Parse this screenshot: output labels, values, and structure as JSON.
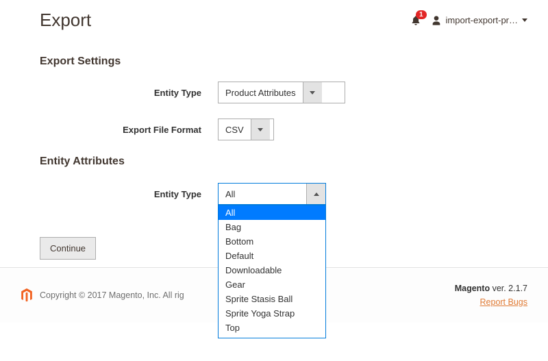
{
  "header": {
    "title": "Export",
    "notification_count": "1",
    "user_name": "import-export-pr…"
  },
  "sections": {
    "export_settings_title": "Export Settings",
    "entity_attributes_title": "Entity Attributes"
  },
  "fields": {
    "entity_type_label": "Entity Type",
    "entity_type_value": "Product Attributes",
    "export_file_format_label": "Export File Format",
    "export_file_format_value": "CSV",
    "attr_entity_type_label": "Entity Type",
    "attr_entity_type_value": "All"
  },
  "dropdown_options": [
    "All",
    "Bag",
    "Bottom",
    "Default",
    "Downloadable",
    "Gear",
    "Sprite Stasis Ball",
    "Sprite Yoga Strap",
    "Top"
  ],
  "dropdown_selected": "All",
  "buttons": {
    "continue": "Continue"
  },
  "footer": {
    "copyright": "Copyright © 2017 Magento, Inc. All rig",
    "version_label": "Magento",
    "version_value": " ver. 2.1.7",
    "report_bugs": "Report Bugs"
  }
}
